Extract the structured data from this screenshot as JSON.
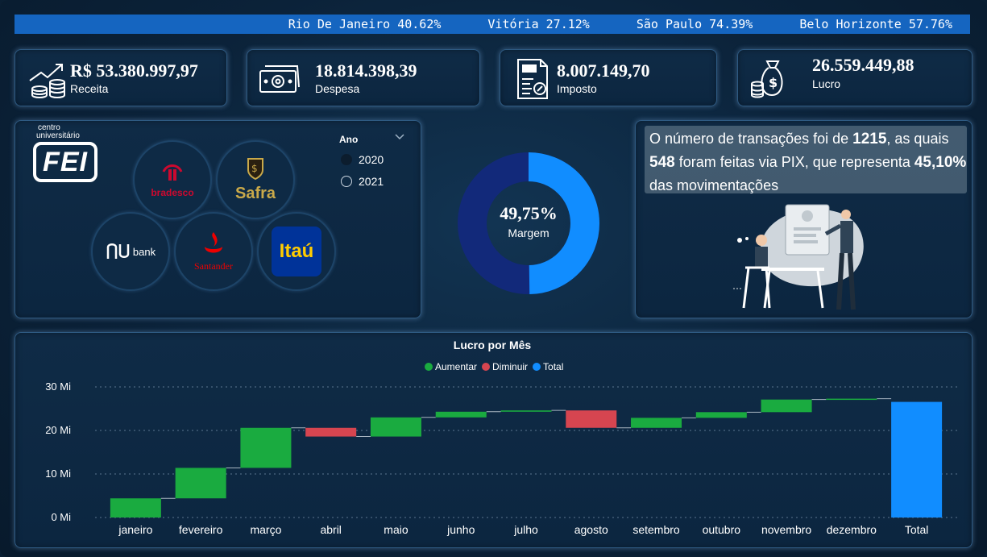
{
  "ticker": [
    {
      "city": "Rio De Janeiro",
      "pct": "40.62%"
    },
    {
      "city": "Vitória",
      "pct": "27.12%"
    },
    {
      "city": "São Paulo",
      "pct": "74.39%"
    },
    {
      "city": "Belo Horizonte",
      "pct": "57.76%"
    }
  ],
  "kpis": [
    {
      "value": "R$ 53.380.997,97",
      "label": "Receita",
      "icon": "revenue-growth-icon"
    },
    {
      "value": "18.814.398,39",
      "label": "Despesa",
      "icon": "cash-bill-icon"
    },
    {
      "value": "8.007.149,70",
      "label": "Imposto",
      "icon": "tax-document-icon"
    },
    {
      "value": "26.559.449,88",
      "label": "Lucro",
      "icon": "money-bag-icon"
    }
  ],
  "fei": {
    "line1": "centro",
    "line2": "universitário",
    "mark": "FEI"
  },
  "banks": [
    {
      "name": "bradesco",
      "text": "bradesco",
      "color": "#cc092f"
    },
    {
      "name": "safra",
      "text": "Safra",
      "color": "#c9a94a"
    },
    {
      "name": "nubank",
      "text": "bank",
      "color": "#ffffff"
    },
    {
      "name": "santander",
      "text": "Santander",
      "color": "#ec0000"
    },
    {
      "name": "itau",
      "text": "Itaú",
      "color": "#ec7000"
    }
  ],
  "year_filter": {
    "title": "Ano",
    "options": [
      "2020",
      "2021"
    ],
    "selected": "2020"
  },
  "margin": {
    "value": "49,75%",
    "label": "Margem",
    "fraction": 0.4975,
    "color_main": "#118dff",
    "color_rest": "#12297a"
  },
  "info": {
    "p1": "O número de transações foi de ",
    "n1": "1215",
    "p2": ", as quais ",
    "n2": "548",
    "p3": " foram feitas via PIX, que representa ",
    "n3": "45,10%",
    "p4": " das movimentações"
  },
  "chart": {
    "title": "Lucro por Mês",
    "legend": [
      {
        "label": "Aumentar",
        "color": "#1aab40"
      },
      {
        "label": "Diminuir",
        "color": "#d64550"
      },
      {
        "label": "Total",
        "color": "#118dff"
      }
    ]
  },
  "chart_data": {
    "type": "waterfall",
    "title": "Lucro por Mês",
    "categories": [
      "janeiro",
      "fevereiro",
      "março",
      "abril",
      "maio",
      "junho",
      "julho",
      "agosto",
      "setembro",
      "outubro",
      "novembro",
      "dezembro",
      "Total"
    ],
    "deltas": [
      4.4,
      7.0,
      9.2,
      -2.0,
      4.4,
      1.3,
      0.3,
      -4.0,
      2.3,
      1.3,
      2.9,
      0.2,
      null
    ],
    "total": 26.56,
    "y_ticks": [
      "0 Mi",
      "10 Mi",
      "20 Mi",
      "30 Mi"
    ],
    "ylim": [
      0,
      30
    ],
    "grid": true
  }
}
